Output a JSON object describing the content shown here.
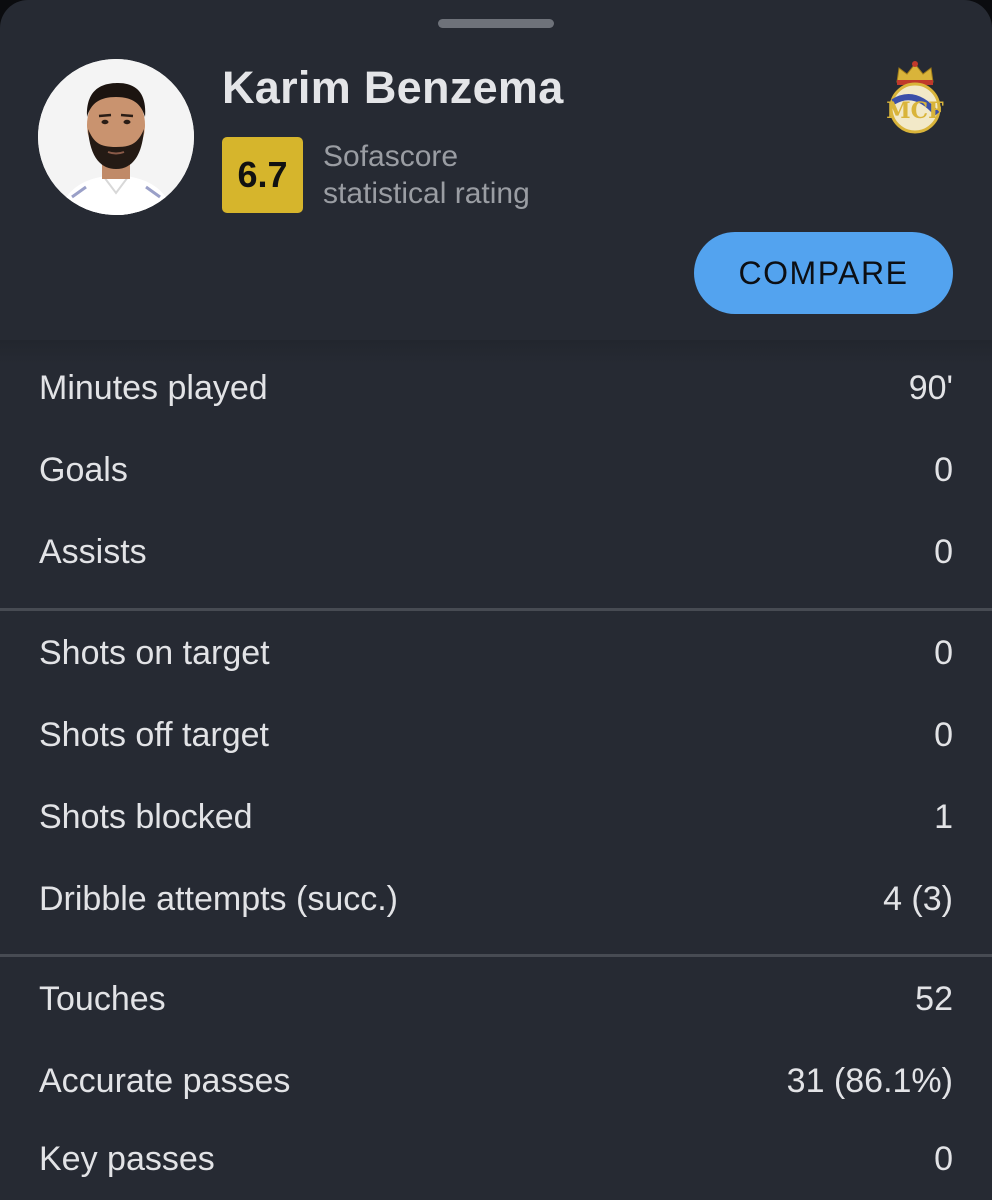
{
  "player": {
    "name": "Karim Benzema",
    "rating": "6.7",
    "rating_label_line1": "Sofascore",
    "rating_label_line2": "statistical rating"
  },
  "actions": {
    "compare_label": "COMPARE"
  },
  "icons": {
    "avatar": "player-photo",
    "club": "real-madrid-crest-icon"
  },
  "colors": {
    "background": "#262a33",
    "rating_badge": "#d6b52c",
    "compare_button": "#53a3ef",
    "divider": "#474b53"
  },
  "stats": {
    "group1": [
      {
        "label": "Minutes played",
        "value": "90'"
      },
      {
        "label": "Goals",
        "value": "0"
      },
      {
        "label": "Assists",
        "value": "0"
      }
    ],
    "group2": [
      {
        "label": "Shots on target",
        "value": "0"
      },
      {
        "label": "Shots off target",
        "value": "0"
      },
      {
        "label": "Shots blocked",
        "value": "1"
      },
      {
        "label": "Dribble attempts (succ.)",
        "value": "4 (3)"
      }
    ],
    "group3": [
      {
        "label": "Touches",
        "value": "52"
      },
      {
        "label": "Accurate passes",
        "value": "31 (86.1%)"
      },
      {
        "label": "Key passes",
        "value": "0"
      }
    ]
  }
}
